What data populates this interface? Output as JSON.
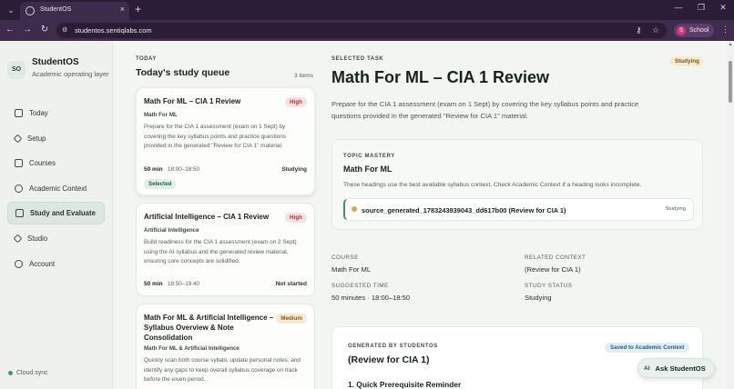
{
  "browser": {
    "tab_title": "StudentOS",
    "url": "studentos.sentiqlabs.com",
    "profile_initial": "S",
    "profile_label": "School",
    "new_tab_glyph": "+",
    "close_glyph": "×"
  },
  "sidebar": {
    "badge": "SO",
    "brand": "StudentOS",
    "subtitle": "Academic operating layer",
    "items": [
      {
        "label": "Today",
        "icon": "square-icon"
      },
      {
        "label": "Setup",
        "icon": "diamond-icon"
      },
      {
        "label": "Courses",
        "icon": "square-icon"
      },
      {
        "label": "Academic Context",
        "icon": "circle-icon"
      },
      {
        "label": "Study and Evaluate",
        "icon": "square-icon"
      },
      {
        "label": "Studio",
        "icon": "diamond-icon"
      },
      {
        "label": "Account",
        "icon": "circle-icon"
      }
    ],
    "active_item": "Study and Evaluate",
    "sync": "Cloud sync"
  },
  "queue": {
    "eyebrow": "TODAY",
    "title": "Today's study queue",
    "count": "3 items",
    "cards": [
      {
        "title": "Math For ML – CIA 1 Review",
        "priority": "High",
        "course": "Math For ML",
        "description": "Prepare for the CIA 1 assessment (exam on 1 Sept) by covering the key syllabus points and practice questions provided in the generated \"Review for CIA 1\" material.",
        "duration": "50 min",
        "time": "18:00–18:50",
        "status": "Studying",
        "selected_label": "Selected"
      },
      {
        "title": "Artificial Intelligence – CIA 1 Review",
        "priority": "High",
        "course": "Artificial Intelligence",
        "description": "Build readiness for the CIA 1 assessment (exam on 2 Sept) using the AI syllabus and the generated review material, ensuring core concepts are solidified.",
        "duration": "50 min",
        "time": "18:50–19:40",
        "status": "Not started"
      },
      {
        "title": "Math For ML & Artificial Intelligence – Syllabus Overview & Note Consolidation",
        "priority": "Medium",
        "course": "Math For ML & Artificial Intelligence",
        "description": "Quickly scan both course syllabi, update personal notes, and identify any gaps to keep overall syllabus coverage on track before the exam period."
      }
    ]
  },
  "detail": {
    "eyebrow": "SELECTED TASK",
    "status": "Studying",
    "title": "Math For ML – CIA 1 Review",
    "description": "Prepare for the CIA 1 assessment (exam on 1 Sept) by covering the key syllabus points and practice questions provided in the generated \"Review for CIA 1\" material.",
    "mastery": {
      "eyebrow": "TOPIC MASTERY",
      "title": "Math For ML",
      "note": "These headings use the best available syllabus context. Check Academic Context if a heading looks incomplete.",
      "source_label": "source_generated_1783243939043_dd617b00 (Review for CIA 1)",
      "source_status": "Studying"
    },
    "meta": {
      "course_label": "COURSE",
      "course_value": "Math For ML",
      "context_label": "RELATED CONTEXT",
      "context_value": "(Review for CIA 1)",
      "time_label": "SUGGESTED TIME",
      "time_value": "50 minutes · 18:00–18:50",
      "status_label": "STUDY STATUS",
      "status_value": "Studying"
    },
    "generated": {
      "eyebrow": "GENERATED BY STUDENTOS",
      "saved": "Saved to Academic Context",
      "title": "(Review for CIA 1)",
      "section": "1. Quick Prerequisite Reminder"
    }
  },
  "assistant": {
    "badge": "AI",
    "label": "Ask StudentOS"
  }
}
